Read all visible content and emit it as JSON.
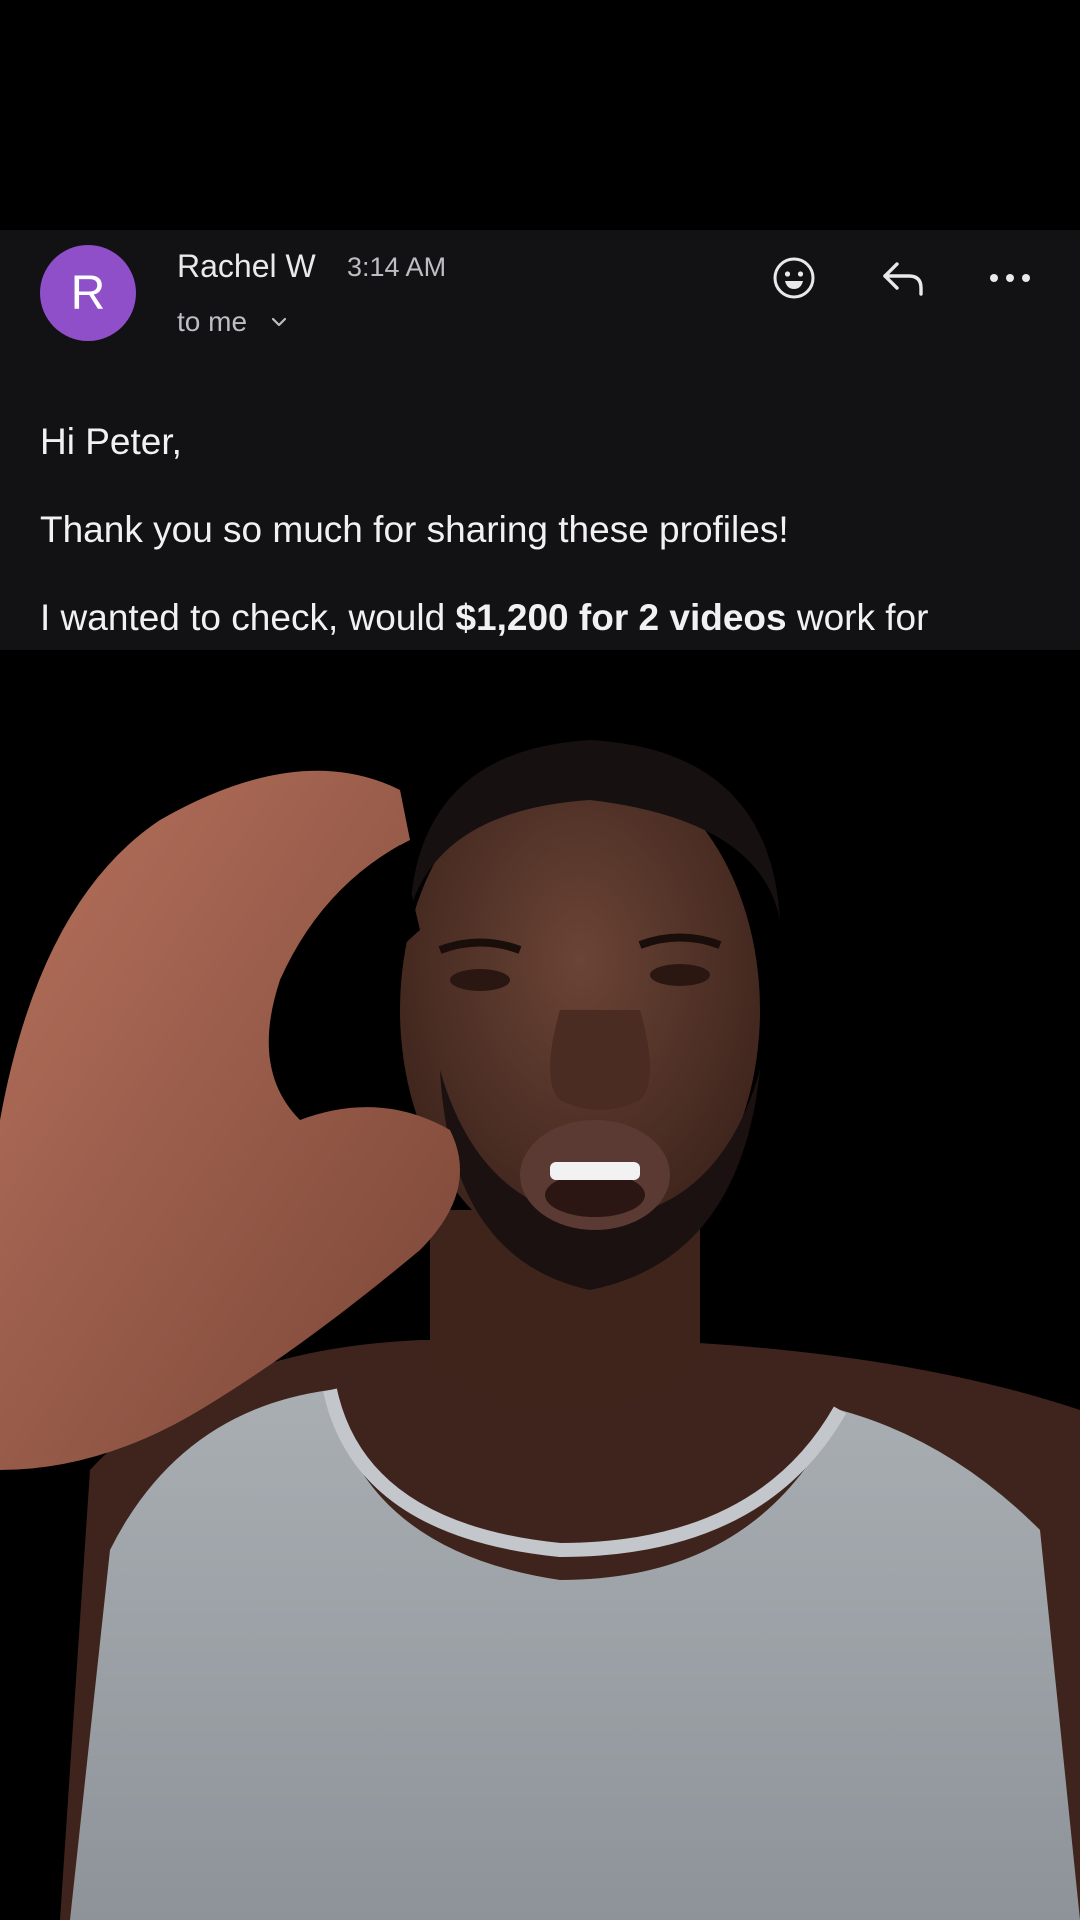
{
  "email": {
    "avatar_letter": "R",
    "sender": "Rachel W",
    "time": "3:14 AM",
    "recipient": "to me",
    "greeting": "Hi Peter,",
    "line1": "Thank you so much for sharing these profiles!",
    "line2_pre": "I wanted to check, would ",
    "line2_bold": "$1,200 for 2 videos",
    "line2_post": " work for"
  },
  "icons": {
    "react": "emoji-icon",
    "reply": "reply-icon",
    "more": "more-options-icon"
  },
  "colors": {
    "avatar": "#8e4fc9",
    "panel": "#121214",
    "text": "#f1f1f4",
    "muted": "#bdbdc2"
  }
}
